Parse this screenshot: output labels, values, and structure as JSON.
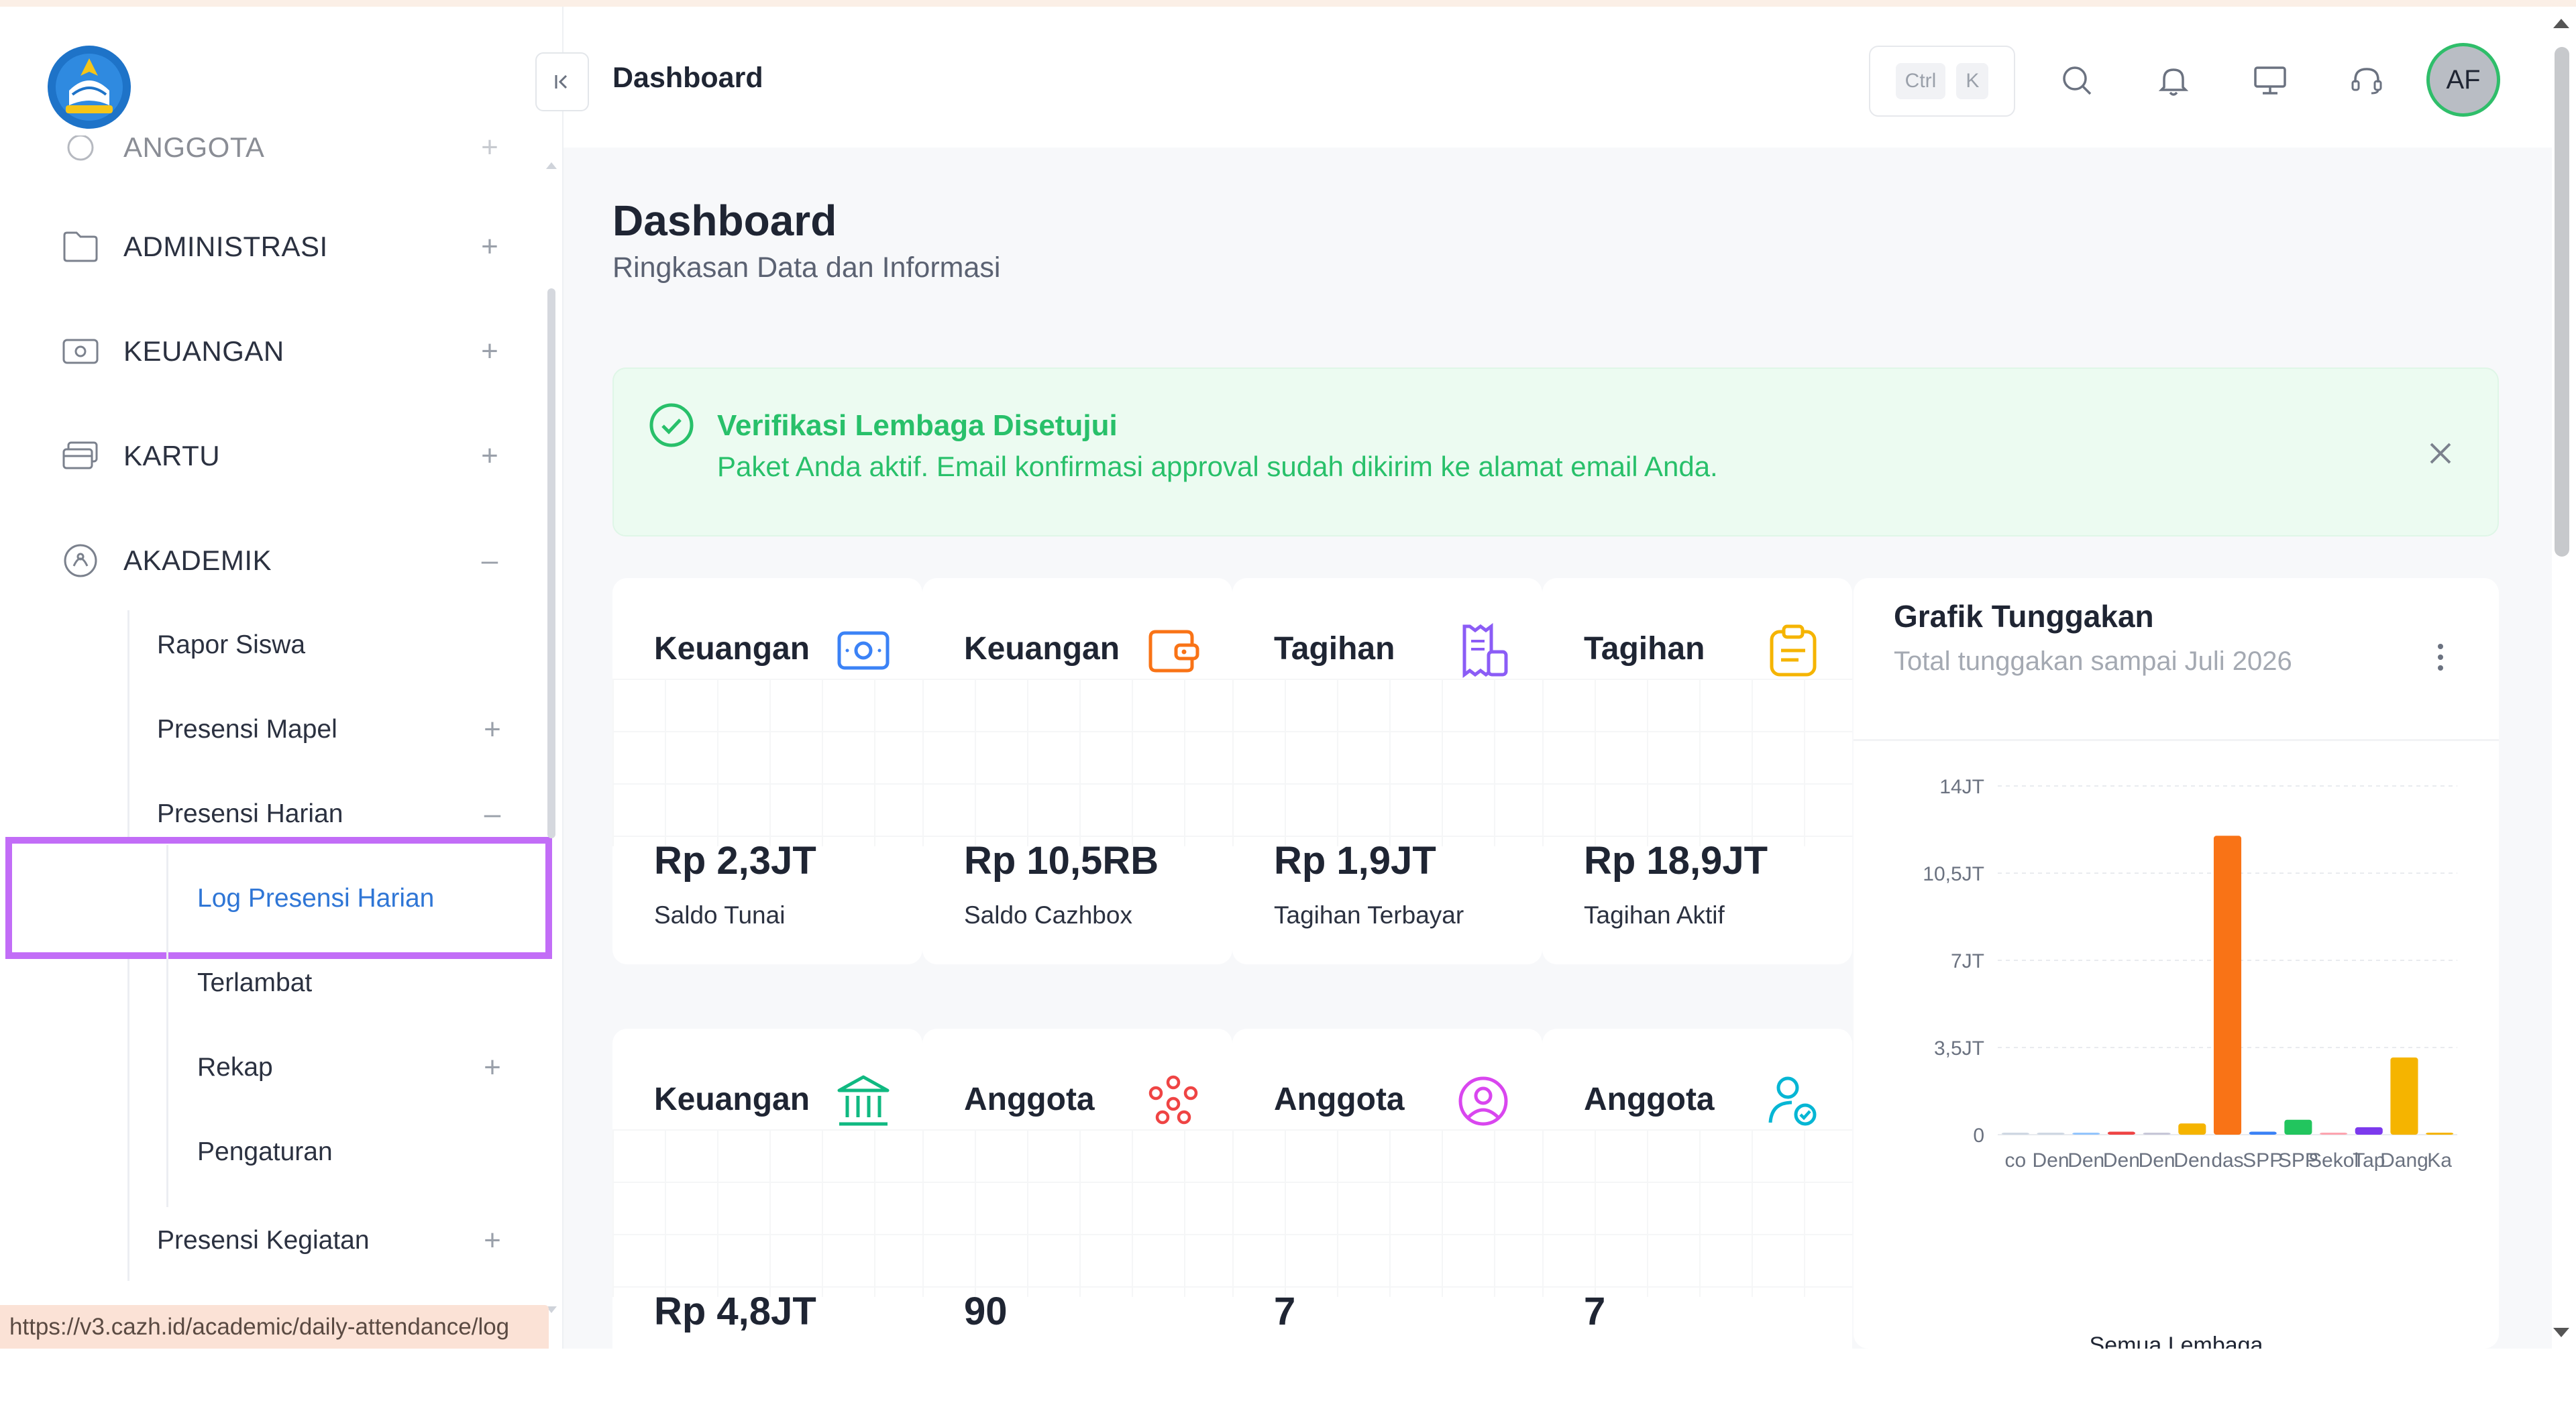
{
  "header": {
    "title": "Dashboard",
    "shortcut_keys": [
      "Ctrl",
      "K"
    ],
    "avatar_initials": "AF"
  },
  "sidebar": {
    "cut_item_label": "ANGGOTA",
    "items": [
      {
        "label": "ADMINISTRASI",
        "toggle": "+"
      },
      {
        "label": "KEUANGAN",
        "toggle": "+"
      },
      {
        "label": "KARTU",
        "toggle": "+"
      },
      {
        "label": "AKADEMIK",
        "toggle": "–"
      }
    ],
    "sub_items": [
      {
        "label": "Rapor Siswa",
        "toggle": ""
      },
      {
        "label": "Presensi Mapel",
        "toggle": "+"
      },
      {
        "label": "Presensi Harian",
        "toggle": "–"
      }
    ],
    "nested_items": [
      {
        "label": "Log Presensi Harian",
        "toggle": "",
        "active": true
      },
      {
        "label": "Terlambat",
        "toggle": ""
      },
      {
        "label": "Rekap",
        "toggle": "+"
      },
      {
        "label": "Pengaturan",
        "toggle": ""
      }
    ],
    "after_item": {
      "label": "Presensi Kegiatan",
      "toggle": "+"
    }
  },
  "status_url": "https://v3.cazh.id/academic/daily-attendance/log",
  "page": {
    "title": "Dashboard",
    "subtitle": "Ringkasan Data dan Informasi"
  },
  "alert": {
    "title": "Verifikasi Lembaga Disetujui",
    "message": "Paket Anda aktif. Email konfirmasi approval sudah dikirim ke alamat email Anda."
  },
  "cards": [
    {
      "title": "Keuangan",
      "value": "Rp 2,3JT",
      "caption": "Saldo Tunai",
      "icon": "money-icon",
      "color": "#3b82f6"
    },
    {
      "title": "Keuangan",
      "value": "Rp 10,5RB",
      "caption": "Saldo Cazhbox",
      "icon": "wallet-icon",
      "color": "#f97316"
    },
    {
      "title": "Tagihan",
      "value": "Rp 1,9JT",
      "caption": "Tagihan Terbayar",
      "icon": "invoice-icon",
      "color": "#8b5cf6"
    },
    {
      "title": "Tagihan",
      "value": "Rp 18,9JT",
      "caption": "Tagihan Aktif",
      "icon": "clipboard-icon",
      "color": "#f5b400"
    },
    {
      "title": "Keuangan",
      "value": "Rp 4,8JT",
      "caption": "",
      "icon": "bank-icon",
      "color": "#10b981"
    },
    {
      "title": "Anggota",
      "value": "90",
      "caption": "",
      "icon": "group-icon",
      "color": "#ef4444"
    },
    {
      "title": "Anggota",
      "value": "7",
      "caption": "",
      "icon": "user-circle-icon",
      "color": "#d946ef"
    },
    {
      "title": "Anggota",
      "value": "7",
      "caption": "",
      "icon": "user-check-icon",
      "color": "#06b6d4"
    }
  ],
  "chart": {
    "title": "Grafik Tunggakan",
    "subtitle": "Total tunggakan sampai Juli 2026",
    "footer": "Semua Lembaga"
  },
  "chart_data": {
    "type": "bar",
    "title": "Grafik Tunggakan",
    "subtitle": "Total tunggakan sampai Juli 2026",
    "y_ticks": [
      "0",
      "3,5JT",
      "7JT",
      "10,5JT",
      "14JT"
    ],
    "ylim": [
      0,
      14
    ],
    "unit": "JT",
    "categories": [
      "co",
      "Den",
      "Den",
      "Den",
      "Den",
      "Den",
      "dasi",
      "SPP",
      "SPP",
      "Sekolah",
      "Tapo",
      "Dana",
      "Ka"
    ],
    "x_tick_text": [
      "co",
      "Den",
      "Den",
      "Den",
      "Den",
      "Den",
      "das",
      "SPP",
      "SPP",
      "Sekol",
      "Tap",
      "Dang",
      "Ka"
    ],
    "values": [
      0.02,
      0.03,
      0.05,
      0.12,
      0.05,
      0.45,
      12.0,
      0.12,
      0.6,
      0.06,
      0.3,
      3.1,
      0
    ],
    "colors": [
      "#cfd8e3",
      "#cfd8e3",
      "#93c5fd",
      "#ef4444",
      "#c7c7d8",
      "#f5b400",
      "#f97316",
      "#3b82f6",
      "#22c55e",
      "#fda4af",
      "#7c3aed",
      "#f5b400",
      "#f5b400"
    ],
    "grid": true
  }
}
